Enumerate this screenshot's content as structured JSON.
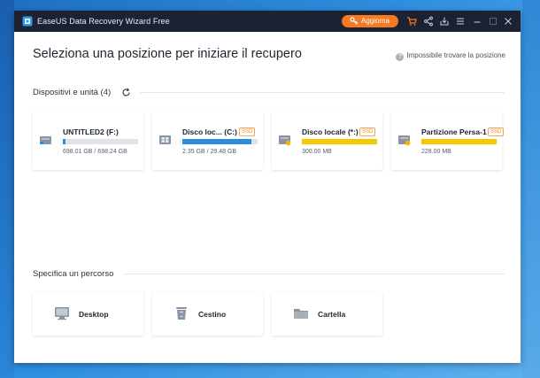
{
  "window": {
    "title": "EaseUS Data Recovery Wizard Free",
    "upgrade_label": "Aggiorna",
    "accent": "#f57a23",
    "titlebar_color": "#1b2333"
  },
  "main": {
    "heading": "Seleziona una posizione per iniziare il recupero",
    "help_text": "Impossibile trovare la posizione",
    "help_mark": "?"
  },
  "devices": {
    "title": "Dispositivi e unità (4)",
    "items": [
      {
        "name": "UNTITLED2 (F:)",
        "ssd": "",
        "size": "698.01 GB / 698.24 GB",
        "usage": 0.03,
        "color": "#2a8de0",
        "icon": "usb-drive-icon"
      },
      {
        "name": "Disco loc... (C:)",
        "ssd": "SSD",
        "size": "2.35 GB / 29.48 GB",
        "usage": 0.92,
        "color": "#2a8de0",
        "icon": "windows-drive-icon"
      },
      {
        "name": "Disco locale (*:)",
        "ssd": "SSD",
        "size": "300.00 MB",
        "usage": 1.0,
        "color": "#f5c800",
        "icon": "lost-drive-icon"
      },
      {
        "name": "Partizione Persa-1",
        "ssd": "SSD",
        "size": "228.00 MB",
        "usage": 1.0,
        "color": "#f5c800",
        "icon": "lost-partition-icon"
      }
    ]
  },
  "paths": {
    "title": "Specifica un percorso",
    "items": [
      {
        "label": "Desktop",
        "icon": "desktop-icon"
      },
      {
        "label": "Cestino",
        "icon": "recycle-bin-icon"
      },
      {
        "label": "Cartella",
        "icon": "folder-icon"
      }
    ]
  }
}
